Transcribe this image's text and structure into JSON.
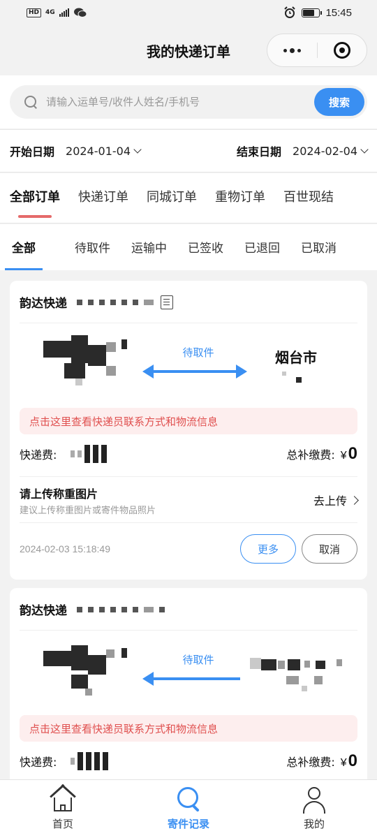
{
  "status_bar": {
    "hd": "HD",
    "network": "4G",
    "time": "15:45",
    "battery_level": 0.7
  },
  "navbar": {
    "title": "我的快递订单"
  },
  "search": {
    "placeholder": "请输入运单号/收件人姓名/手机号",
    "button": "搜索"
  },
  "dates": {
    "start_label": "开始日期",
    "start_value": "2024-01-04",
    "end_label": "结束日期",
    "end_value": "2024-02-04"
  },
  "order_types": [
    "全部订单",
    "快递订单",
    "同城订单",
    "重物订单",
    "百世现结"
  ],
  "status_tabs": [
    "全部",
    "待取件",
    "运输中",
    "已签收",
    "已退回",
    "已取消"
  ],
  "orders": [
    {
      "carrier": "韵达快递",
      "status": "待取件",
      "dest_city": "烟台市",
      "notice": "点击这里查看快递员联系方式和物流信息",
      "fee_label": "快递费:",
      "total_label": "总补缴费:",
      "total_currency": "¥",
      "total_value": "0",
      "upload_title": "请上传称重图片",
      "upload_sub": "建议上传称重图片或寄件物品照片",
      "upload_link": "去上传",
      "time": "2024-02-03 15:18:49",
      "more_btn": "更多",
      "cancel_btn": "取消"
    },
    {
      "carrier": "韵达快递",
      "status": "待取件",
      "notice": "点击这里查看快递员联系方式和物流信息",
      "fee_label": "快递费:",
      "total_label": "总补缴费:",
      "total_currency": "¥",
      "total_value": "0"
    }
  ],
  "tabbar": [
    "首页",
    "寄件记录",
    "我的"
  ],
  "colors": {
    "accent": "#3a8ff2",
    "notice_text": "#e0504f",
    "notice_bg": "#fdeeee",
    "active_type_underline": "#e56a6a"
  }
}
